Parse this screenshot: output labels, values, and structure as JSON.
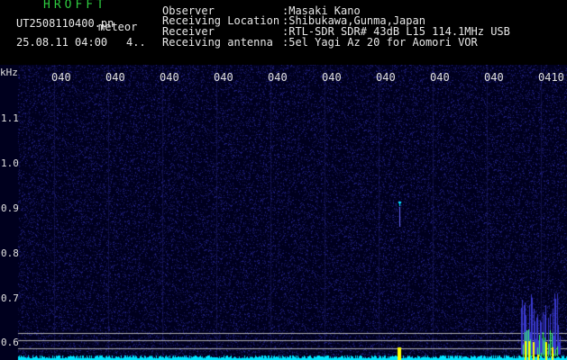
{
  "header": {
    "brand": "HROFFT",
    "filename": "UT2508110400.pn",
    "meteor_label": "meteor",
    "timestamp": "25.08.11 04:00",
    "counter": "4..",
    "info": [
      {
        "key": "Observer",
        "value": ":Masaki Kano"
      },
      {
        "key": "Receiving Location",
        "value": ":Shibukawa,Gunma,Japan"
      },
      {
        "key": "Receiver",
        "value": ":RTL-SDR SDR# 43dB L15 114.1MHz USB"
      },
      {
        "key": "Receiving antenna",
        "value": ":5el Yagi Az 20 for Aomori VOR"
      }
    ]
  },
  "plot": {
    "y_unit": "kHz",
    "y_ticks": [
      "1.1",
      "1.0",
      "0.9",
      "0.8",
      "0.7",
      "0.6"
    ],
    "x_labels": [
      "040",
      "040",
      "040",
      "040",
      "040",
      "040",
      "040",
      "040",
      "040",
      "0410"
    ],
    "colors": {
      "background": "#00001e",
      "noise": "#1c1c7a",
      "grid_v": "#2a2a8c",
      "signal_cyan": "#00e5ff",
      "signal_yellow": "#ffff00",
      "signal_green": "#33ff66",
      "hline": "#b0b0b0"
    }
  }
}
